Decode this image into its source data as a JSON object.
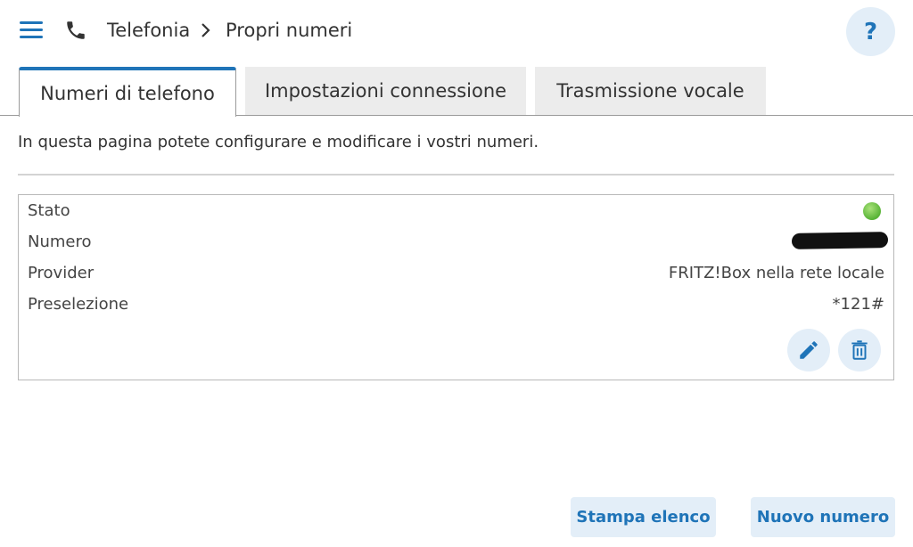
{
  "header": {
    "menu_icon": "hamburger-menu-icon",
    "section_icon": "phone-icon",
    "breadcrumb": [
      "Telefonia",
      "Propri numeri"
    ],
    "help_label": "?"
  },
  "tabs": [
    {
      "label": "Numeri di telefono",
      "active": true
    },
    {
      "label": "Impostazioni connessione",
      "active": false
    },
    {
      "label": "Trasmissione vocale",
      "active": false
    }
  ],
  "intro_text": "In questa pagina potete configurare e modificare i vostri numeri.",
  "number_entry": {
    "status_label": "Stato",
    "status_color": "#58b336",
    "number_label": "Numero",
    "provider_label": "Provider",
    "provider_value": "FRITZ!Box nella rete locale",
    "preselection_label": "Preselezione",
    "preselection_value": "*121#"
  },
  "actions": {
    "print_label": "Stampa elenco",
    "new_label": "Nuovo numero"
  },
  "colors": {
    "accent": "#1f74b8",
    "button_bg": "#e3eef8"
  }
}
